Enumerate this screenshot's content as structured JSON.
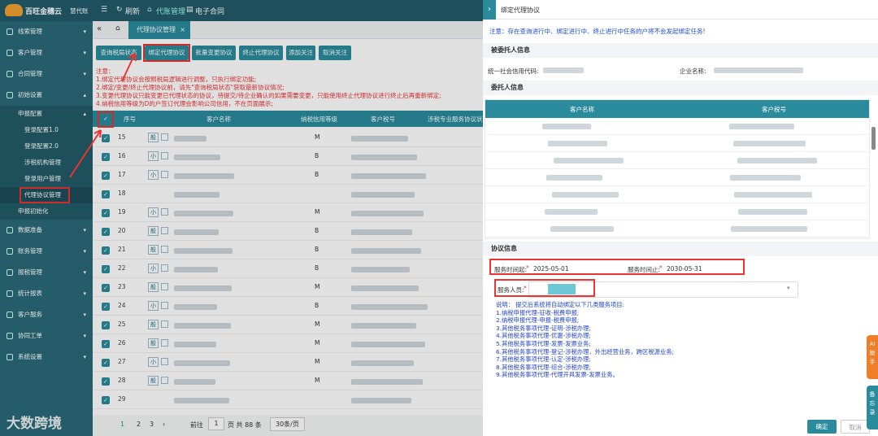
{
  "topbar": {
    "brand": "百旺金穗云",
    "brand_sub": "慧代账",
    "refresh": "刷新",
    "nav_active": "代账管理",
    "nav_econtract": "电子合同"
  },
  "sidebar": {
    "items": [
      {
        "label": "线索管理",
        "expanded": false
      },
      {
        "label": "客户管理",
        "expanded": false
      },
      {
        "label": "合同管理",
        "expanded": false
      },
      {
        "label": "初始设置",
        "expanded": true
      },
      {
        "label": "申报配置",
        "expanded": true
      },
      {
        "label": "登录配置1.0"
      },
      {
        "label": "登录配置2.0"
      },
      {
        "label": "涉税机构管理"
      },
      {
        "label": "登录用户管理"
      },
      {
        "label": "代理协议管理",
        "active": true
      },
      {
        "label": "申报初始化"
      },
      {
        "label": "数据准备"
      },
      {
        "label": "账务管理"
      },
      {
        "label": "报税管理"
      },
      {
        "label": "统计报表"
      },
      {
        "label": "客户服务"
      },
      {
        "label": "协同工单"
      },
      {
        "label": "系统设置"
      }
    ]
  },
  "tabs": {
    "active": "代理协议管理"
  },
  "toolbar": {
    "buttons": [
      "查询税局状态",
      "绑定代理协议",
      "批量变更协议",
      "终止代理协议",
      "添加关注",
      "取消关注"
    ]
  },
  "notes": [
    "注意：",
    "1.绑定代理协议会按照税局逻辑进行调整，只执行绑定功能;",
    "2.绑定/变更/终止代理协议前，请先\"查询税局状态\"获取最新协议情况;",
    "3.变更代理协议只能变更已代理状态的协议，待提交/待企业确认的如果需要变更，只能使用终止代理协议进行终止后再重新绑定;",
    "4.纳税信用等级为D的户签订代理会影响公司信用，不在页面展示;"
  ],
  "table": {
    "headers": [
      "序号",
      "客户名称",
      "纳税信用等级",
      "客户税号",
      "涉税专业服务协议状"
    ],
    "rows": [
      {
        "seq": "15",
        "tag": "般",
        "level": "M"
      },
      {
        "seq": "16",
        "tag": "小",
        "level": "B"
      },
      {
        "seq": "17",
        "tag": "小",
        "level": "B"
      },
      {
        "seq": "18",
        "tag": "",
        "level": ""
      },
      {
        "seq": "19",
        "tag": "小",
        "level": "M"
      },
      {
        "seq": "20",
        "tag": "般",
        "level": "B"
      },
      {
        "seq": "21",
        "tag": "般",
        "level": "B"
      },
      {
        "seq": "22",
        "tag": "小",
        "level": "B"
      },
      {
        "seq": "23",
        "tag": "般",
        "level": "M"
      },
      {
        "seq": "24",
        "tag": "小",
        "level": "B"
      },
      {
        "seq": "25",
        "tag": "般",
        "level": "M"
      },
      {
        "seq": "26",
        "tag": "般",
        "level": "M"
      },
      {
        "seq": "27",
        "tag": "小",
        "level": "M"
      },
      {
        "seq": "28",
        "tag": "般",
        "level": "M"
      },
      {
        "seq": "29",
        "tag": "",
        "level": ""
      }
    ]
  },
  "pagination": {
    "pages": [
      "1",
      "2",
      "3"
    ],
    "goto_label": "前往",
    "page_value": "1",
    "total": "页 共 88 条",
    "page_size": "30条/页"
  },
  "drawer": {
    "title": "绑定代理协议",
    "warning": "注意：存在查询进行中、绑定进行中、终止进行中任务的户将不会发起绑定任务!",
    "principal_title": "被委托人信息",
    "credit_code_label": "统一社会信用代码:",
    "company_label": "企业名称:",
    "client_title": "委托人信息",
    "client_headers": [
      "客户名称",
      "客户税号"
    ],
    "client_rows": 8,
    "agreement_title": "协议信息",
    "start_label": "服务时间起:",
    "start_value": "2025-05-01",
    "end_label": "服务时间止:",
    "end_value": "2030-05-31",
    "staff_label": "服务人员:",
    "desc": [
      "说明：  提交后系统将自动绑定以下几类服务项目:",
      "1.纳税申报代理-征收-税费申报;",
      "2.纳税申报代理-申报-税费申报;",
      "3.其他税务事项代理-证明-涉税办理;",
      "4.其他税务事项代理-优惠-涉税办理;",
      "5.其他税务事项代理-发票-发票业务;",
      "6.其他税务事项代理-登记-涉税办理，外出经营业务，跨区税源业务;",
      "7.其他税务事项代理-认定-涉税办理;",
      "8.其他税务事项代理-综合-涉税办理;",
      "9.其他税务事项代理-代理开具发票-发票业务。"
    ],
    "confirm": "确定",
    "cancel": "取消"
  },
  "float": {
    "ai": "AI助手",
    "backup": "备忘录"
  },
  "watermark": "大数跨境"
}
